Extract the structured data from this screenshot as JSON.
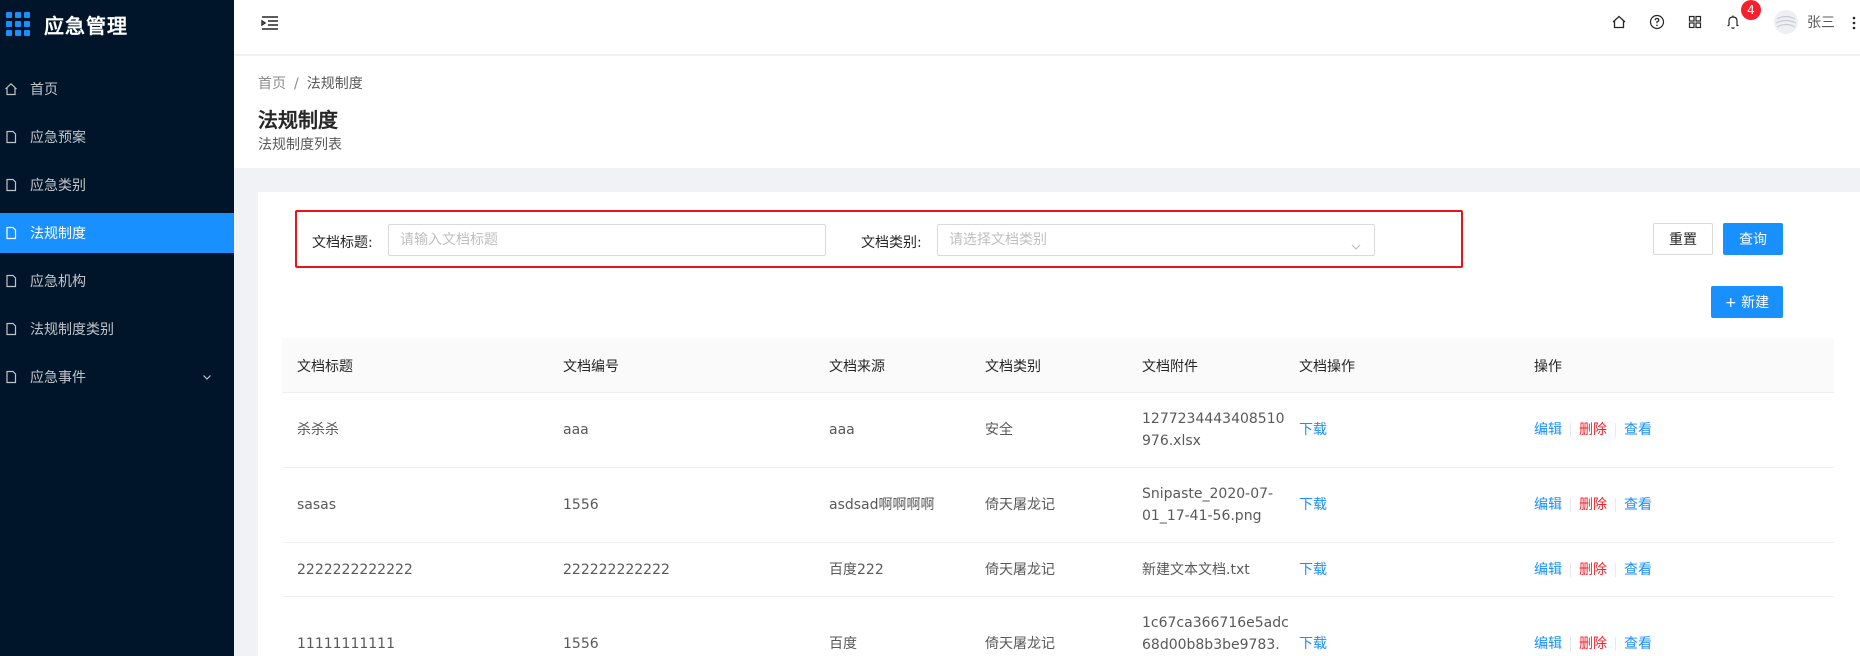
{
  "app": {
    "title": "应急管理"
  },
  "sidebar": {
    "items": [
      {
        "label": "首页",
        "icon": "home-icon",
        "active": false
      },
      {
        "label": "应急预案",
        "icon": "file-icon",
        "active": false
      },
      {
        "label": "应急类别",
        "icon": "file-icon",
        "active": false
      },
      {
        "label": "法规制度",
        "icon": "file-icon",
        "active": true
      },
      {
        "label": "应急机构",
        "icon": "file-icon",
        "active": false
      },
      {
        "label": "法规制度类别",
        "icon": "file-icon",
        "active": false
      },
      {
        "label": "应急事件",
        "icon": "file-icon",
        "active": false,
        "expandable": true
      }
    ]
  },
  "header": {
    "notification_count": "4",
    "username": "张三"
  },
  "breadcrumb": {
    "home": "首页",
    "separator": "/",
    "current": "法规制度"
  },
  "page": {
    "title": "法规制度",
    "subtitle": "法规制度列表"
  },
  "search": {
    "title_label": "文档标题:",
    "title_placeholder": "请输入文档标题",
    "category_label": "文档类别:",
    "category_placeholder": "请选择文档类别",
    "reset_label": "重置",
    "query_label": "查询",
    "new_label": "+ 新建"
  },
  "table": {
    "columns": [
      "文档标题",
      "文档编号",
      "文档来源",
      "文档类别",
      "文档附件",
      "文档操作",
      "操作"
    ],
    "rows": [
      {
        "title": "杀杀杀",
        "code": "aaa",
        "source": "aaa",
        "category": "安全",
        "attachment_line1": "1277234443408510",
        "attachment_line2": "976.xlsx",
        "download": "下载",
        "edit": "编辑",
        "delete": "删除",
        "view": "查看"
      },
      {
        "title": "sasas",
        "code": "1556",
        "source": "asdsad啊啊啊啊",
        "category": "倚天屠龙记",
        "attachment_line1": "Snipaste_2020-07-",
        "attachment_line2": "01_17-41-56.png",
        "download": "下载",
        "edit": "编辑",
        "delete": "删除",
        "view": "查看"
      },
      {
        "title": "2222222222222",
        "code": "222222222222",
        "source": "百度222",
        "category": "倚天屠龙记",
        "attachment_line1": "新建文本文档.txt",
        "attachment_line2": "",
        "download": "下载",
        "edit": "编辑",
        "delete": "删除",
        "view": "查看"
      },
      {
        "title": "11111111111",
        "code": "1556",
        "source": "百度",
        "category": "倚天屠龙记",
        "attachment_line1": "1c67ca366716e5adc",
        "attachment_line2": "68d00b8b3be9783.",
        "download": "下载",
        "edit": "编辑",
        "delete": "删除",
        "view": "查看"
      }
    ]
  },
  "colors": {
    "sidebar_bg": "#001529",
    "primary": "#1890ff",
    "danger": "#f5222d",
    "highlight_border": "#e8141a"
  }
}
